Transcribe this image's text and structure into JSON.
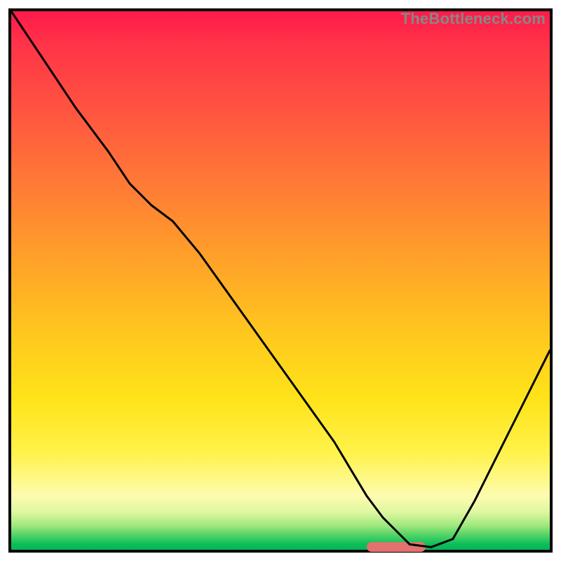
{
  "attribution": "TheBottleneck.com",
  "chart_data": {
    "type": "line",
    "title": "",
    "xlabel": "",
    "ylabel": "",
    "xlim": [
      0,
      100
    ],
    "ylim": [
      0,
      100
    ],
    "annotations": [],
    "series": [
      {
        "name": "bottleneck-curve",
        "x": [
          0,
          6,
          12,
          18,
          22,
          26,
          30,
          35,
          40,
          45,
          50,
          55,
          60,
          63,
          66,
          69,
          72,
          74,
          78,
          82,
          86,
          90,
          94,
          98,
          100
        ],
        "y": [
          100,
          91,
          82,
          74,
          68,
          64,
          61,
          55,
          48,
          41,
          34,
          27,
          20,
          15,
          10,
          6,
          3,
          1,
          0.5,
          2,
          9,
          17,
          25,
          33,
          37
        ]
      }
    ],
    "optimal_marker": {
      "x_start": 66,
      "x_end": 77,
      "y": 0.5
    },
    "gradient_legend": {
      "orientation": "vertical",
      "top_meaning": "severe-bottleneck",
      "bottom_meaning": "no-bottleneck",
      "stops": [
        {
          "pos": 0.0,
          "color": "#ff1a4a"
        },
        {
          "pos": 0.18,
          "color": "#ff5340"
        },
        {
          "pos": 0.46,
          "color": "#ffa129"
        },
        {
          "pos": 0.72,
          "color": "#ffe31a"
        },
        {
          "pos": 0.9,
          "color": "#fdfcb0"
        },
        {
          "pos": 1.0,
          "color": "#07b557"
        }
      ]
    }
  }
}
